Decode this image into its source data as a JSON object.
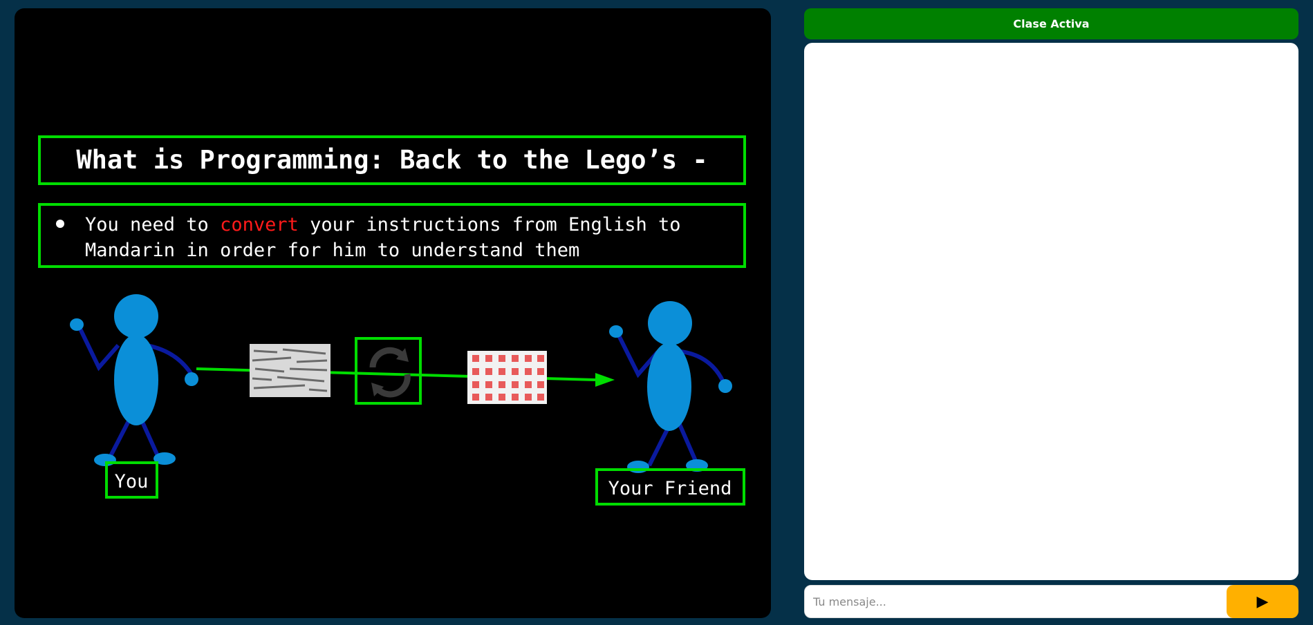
{
  "slide": {
    "title": "What is Programming: Back to the Lego’s -",
    "bullet_line1_a": "You need to ",
    "bullet_line1_b": "convert",
    "bullet_line1_c": " your instructions from English to",
    "bullet_line2": "Mandarin in order for him to understand them",
    "label_you": "You",
    "label_friend": "Your Friend"
  },
  "sidebar": {
    "title": "Clase Activa",
    "input_placeholder": "Tu mensaje...",
    "send_label": "▶"
  },
  "colors": {
    "background": "#053048",
    "green": "#00dd00",
    "accent": "#ffb000",
    "header": "#008000",
    "highlight": "#ff1a1a"
  }
}
